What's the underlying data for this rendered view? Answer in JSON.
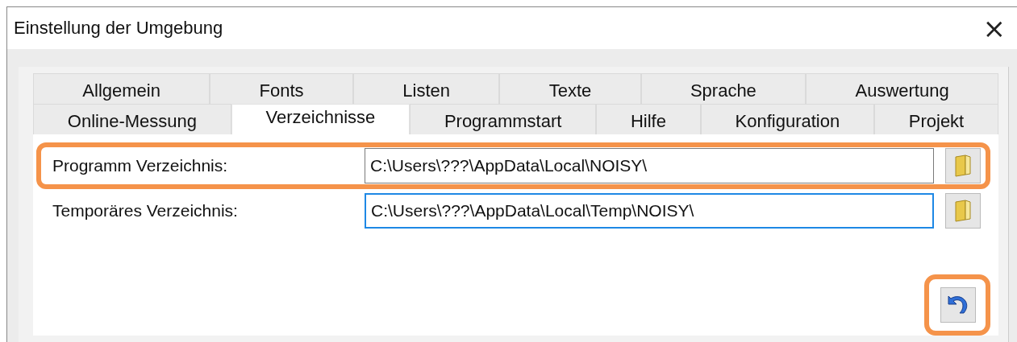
{
  "window": {
    "title": "Einstellung der Umgebung",
    "close": "×"
  },
  "tab_rows": [
    [
      {
        "label": "Allgemein",
        "selected": false
      },
      {
        "label": "Fonts",
        "selected": false
      },
      {
        "label": "Listen",
        "selected": false
      },
      {
        "label": "Texte",
        "selected": false
      },
      {
        "label": "Sprache",
        "selected": false
      },
      {
        "label": "Auswertung",
        "selected": false
      }
    ],
    [
      {
        "label": "Online-Messung",
        "selected": false
      },
      {
        "label": "Verzeichnisse",
        "selected": true
      },
      {
        "label": "Programmstart",
        "selected": false
      },
      {
        "label": "Hilfe",
        "selected": false
      },
      {
        "label": "Konfiguration",
        "selected": false
      },
      {
        "label": "Projekt",
        "selected": false
      }
    ]
  ],
  "fields": [
    {
      "label": "Programm Verzeichnis:",
      "value": "C:\\Users\\???\\AppData\\Local\\NOISY\\",
      "focused": false,
      "highlighted": true
    },
    {
      "label": "Temporäres Verzeichnis:",
      "value": "C:\\Users\\???\\AppData\\Local\\Temp\\NOISY\\",
      "focused": true,
      "highlighted": false
    }
  ],
  "undo_button": {
    "highlighted": true
  }
}
